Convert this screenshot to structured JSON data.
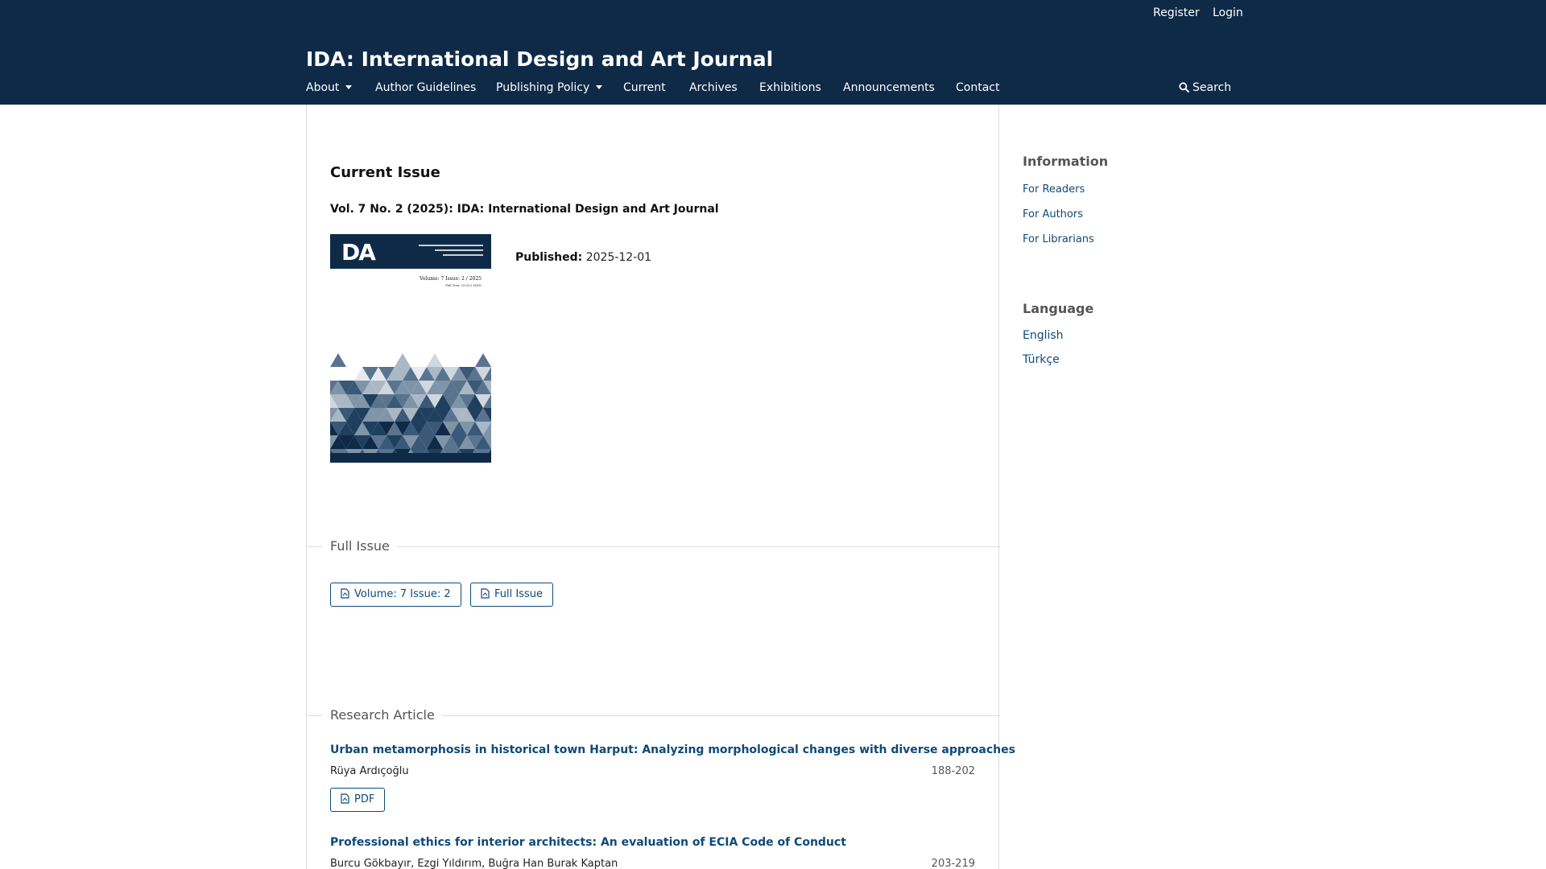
{
  "header": {
    "title": "IDA: International Design and Art Journal",
    "user_nav": {
      "register": "Register",
      "login": "Login"
    },
    "nav": {
      "about": "About",
      "author_guidelines": "Author Guidelines",
      "publishing_policy": "Publishing Policy",
      "current": "Current",
      "archives": "Archives",
      "exhibitions": "Exhibitions",
      "announcements": "Announcements",
      "contact": "Contact"
    },
    "search": "Search"
  },
  "main": {
    "heading": "Current Issue",
    "issue_title": "Vol. 7 No. 2 (2025): IDA: International Design and Art Journal",
    "cover": {
      "logo": "DA",
      "volume_text": "Volume: 7 Issue: 2 / 2025",
      "small_text": "Fall Year 2025/2 ISSN"
    },
    "published_label": "Published:",
    "published_date": "2025-12-01",
    "full_issue": {
      "label": "Full Issue",
      "buttons": [
        "Volume: 7 Issue: 2",
        "Full Issue"
      ]
    },
    "research_article": {
      "label": "Research Article",
      "articles": [
        {
          "title": "Urban metamorphosis in historical town Harput: Analyzing morphological changes with diverse approaches",
          "authors": "Rüya Ardıçoğlu",
          "pages": "188-202",
          "pdf_label": "PDF"
        },
        {
          "title": "Professional ethics for interior architects: An evaluation of ECIA Code of Conduct",
          "authors": "Burcu Gökbayır, Ezgi Yıldırım, Buğra Han Burak Kaptan",
          "pages": "203-219"
        }
      ]
    }
  },
  "sidebar": {
    "information": {
      "title": "Information",
      "links": [
        "For Readers",
        "For Authors",
        "For Librarians"
      ]
    },
    "language": {
      "title": "Language",
      "links": [
        "English",
        "Türkçe"
      ]
    }
  },
  "colors": {
    "header_bg": "#0e2a47",
    "link": "#0e4a7a",
    "border": "#dddddd"
  }
}
